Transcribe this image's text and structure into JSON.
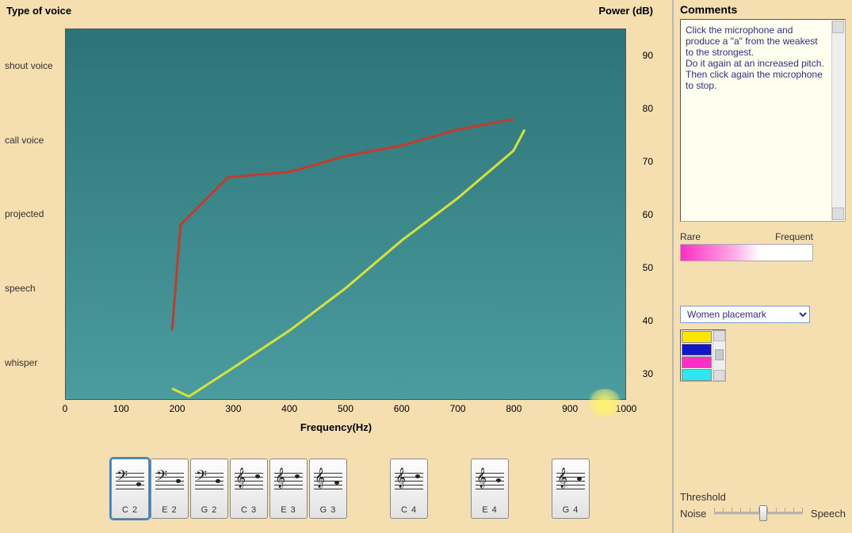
{
  "chart": {
    "title_left": "Type of voice",
    "title_right": "Power (dB)",
    "x_label": "Frequency(Hz)",
    "y_categories": [
      "shout voice",
      "call voice",
      "projected",
      "speech",
      "whisper"
    ],
    "x_ticks": [
      0,
      100,
      200,
      300,
      400,
      500,
      600,
      700,
      800,
      900,
      1000
    ],
    "y2_ticks": [
      30,
      40,
      50,
      60,
      70,
      80,
      90
    ]
  },
  "chart_data": {
    "type": "line",
    "xlabel": "Frequency (Hz)",
    "ylabel": "Power (dB)",
    "xlim": [
      0,
      1000
    ],
    "ylim": [
      25,
      95
    ],
    "series": [
      {
        "name": "red",
        "color": "#c43b2e",
        "x": [
          190,
          205,
          290,
          400,
          500,
          600,
          700,
          800
        ],
        "y": [
          38,
          58,
          67,
          68,
          71,
          73,
          76,
          78
        ]
      },
      {
        "name": "yellow",
        "color": "#d6e23a",
        "x": [
          190,
          220,
          300,
          400,
          500,
          600,
          700,
          800,
          820
        ],
        "y": [
          27,
          25.5,
          31,
          38,
          46,
          55,
          63,
          72,
          76
        ]
      }
    ]
  },
  "notes": {
    "items": [
      {
        "label": "C 2",
        "clef": "bass",
        "selected": true
      },
      {
        "label": "E 2",
        "clef": "bass"
      },
      {
        "label": "G 2",
        "clef": "bass"
      },
      {
        "label": "C 3",
        "clef": "treble"
      },
      {
        "label": "E 3",
        "clef": "treble"
      },
      {
        "label": "G 3",
        "clef": "treble"
      },
      {
        "label": "C 4",
        "clef": "treble",
        "gap_before": true
      },
      {
        "label": "E 4",
        "clef": "treble",
        "gap_before": true
      },
      {
        "label": "G 4",
        "clef": "treble",
        "gap_before": true
      }
    ]
  },
  "right": {
    "comments_title": "Comments",
    "comments_text": "Click the microphone and produce a \"a\" from the weakest\nto the strongest.\nDo it again at an increased pitch. Then click again the microphone to stop.",
    "freq_left": "Rare",
    "freq_right": "Frequent",
    "placemark_selected": "Women placemark",
    "palette": [
      "#ffe600",
      "#1414c8",
      "#ff2ec4",
      "#2ee6f0"
    ],
    "threshold_title": "Threshold",
    "threshold_left": "Noise",
    "threshold_right": "Speech",
    "threshold_value": 0.55
  }
}
